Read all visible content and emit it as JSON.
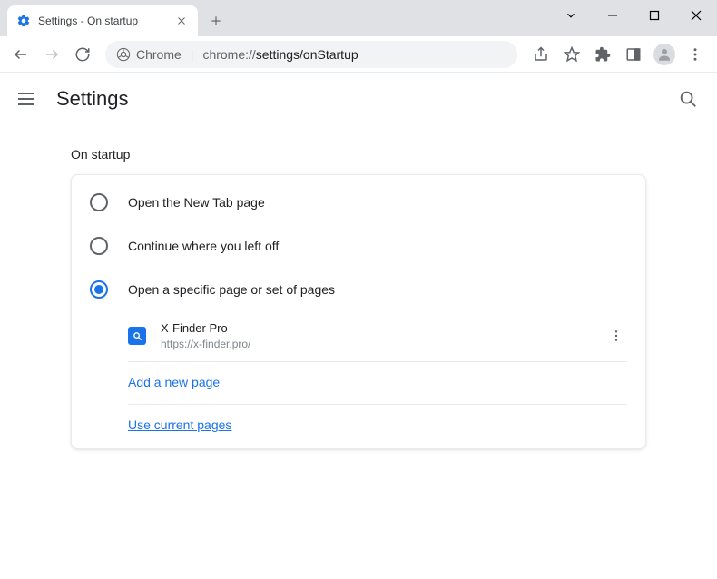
{
  "window": {
    "tab_title": "Settings - On startup"
  },
  "toolbar": {
    "chip_label": "Chrome",
    "url_prefix": "chrome://",
    "url_path": "settings/onStartup"
  },
  "header": {
    "title": "Settings"
  },
  "section": {
    "title": "On startup",
    "options": [
      {
        "label": "Open the New Tab page",
        "selected": false
      },
      {
        "label": "Continue where you left off",
        "selected": false
      },
      {
        "label": "Open a specific page or set of pages",
        "selected": true
      }
    ],
    "pages": [
      {
        "name": "X-Finder Pro",
        "url": "https://x-finder.pro/"
      }
    ],
    "add_page_label": "Add a new page",
    "use_current_label": "Use current pages"
  }
}
